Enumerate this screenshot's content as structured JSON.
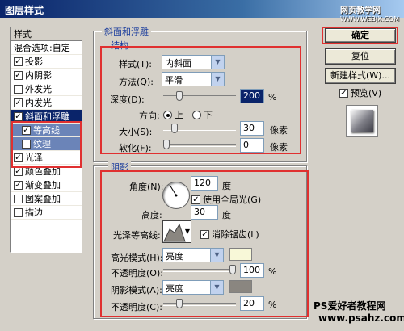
{
  "window": {
    "title": "图层样式",
    "watermark_top": "网页教学网",
    "watermark_top_url": "WWW.WEBJX.COM"
  },
  "sidebar": {
    "items": [
      {
        "label": "样式",
        "checkbox": false,
        "checked": false
      },
      {
        "label": "混合选项:自定",
        "checkbox": false,
        "checked": false
      },
      {
        "label": "投影",
        "checkbox": true,
        "checked": true
      },
      {
        "label": "内阴影",
        "checkbox": true,
        "checked": true
      },
      {
        "label": "外发光",
        "checkbox": true,
        "checked": false
      },
      {
        "label": "内发光",
        "checkbox": true,
        "checked": true
      },
      {
        "label": "斜面和浮雕",
        "checkbox": true,
        "checked": true
      },
      {
        "label": "等高线",
        "checkbox": true,
        "checked": true
      },
      {
        "label": "纹理",
        "checkbox": true,
        "checked": false
      },
      {
        "label": "光泽",
        "checkbox": true,
        "checked": true
      },
      {
        "label": "颜色叠加",
        "checkbox": true,
        "checked": true
      },
      {
        "label": "渐变叠加",
        "checkbox": true,
        "checked": true
      },
      {
        "label": "图案叠加",
        "checkbox": true,
        "checked": false
      },
      {
        "label": "描边",
        "checkbox": true,
        "checked": false
      }
    ]
  },
  "bevel": {
    "section_title": "斜面和浮雕",
    "structure_title": "结构",
    "style_label": "样式(T):",
    "style_value": "内斜面",
    "method_label": "方法(Q):",
    "method_value": "平滑",
    "depth_label": "深度(D):",
    "depth_value": "200",
    "depth_unit": "%",
    "depth_level": 0.2,
    "direction_label": "方向:",
    "dir_up": "上",
    "dir_down": "下",
    "size_label": "大小(S):",
    "size_value": "30",
    "size_unit": "像素",
    "size_level": 0.12,
    "soften_label": "软化(F):",
    "soften_value": "0",
    "soften_unit": "像素",
    "soften_level": 0
  },
  "shading": {
    "title": "阴影",
    "angle_label": "角度(N):",
    "angle_value": "120",
    "angle_unit": "度",
    "global_light_label": "使用全局光(G)",
    "altitude_label": "高度:",
    "altitude_value": "30",
    "altitude_unit": "度",
    "gloss_label": "光泽等高线:",
    "antialias_label": "消除锯齿(L)",
    "highlight_mode_label": "高光模式(H):",
    "highlight_mode_value": "亮度",
    "highlight_color": "#f8f8d8",
    "highlight_opacity_label": "不透明度(O):",
    "highlight_opacity_value": "100",
    "highlight_opacity_unit": "%",
    "highlight_opacity_level": 1.0,
    "shadow_mode_label": "阴影模式(A):",
    "shadow_mode_value": "亮度",
    "shadow_color": "#8a8680",
    "shadow_opacity_label": "不透明度(C):",
    "shadow_opacity_value": "20",
    "shadow_opacity_unit": "%",
    "shadow_opacity_level": 0.2
  },
  "buttons": {
    "ok": "确定",
    "reset": "复位",
    "new_style": "新建样式(W)...",
    "preview": "预览(V)"
  },
  "footer": {
    "watermark_line1": "PS爱好者教程网",
    "watermark_line2": "www.psahz.com"
  }
}
